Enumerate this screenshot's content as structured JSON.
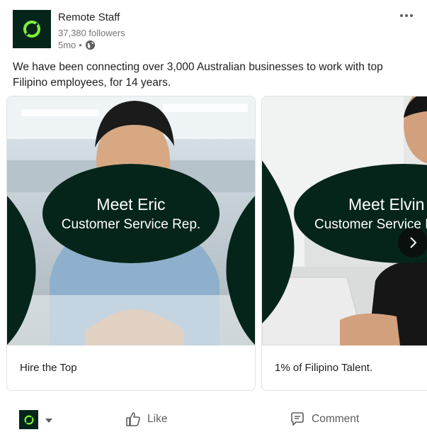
{
  "author": {
    "name": "Remote Staff",
    "followers": "37,380 followers",
    "age": "5mo",
    "separator": "•",
    "visibility_icon": "globe-icon",
    "brand_color": "#06251a",
    "accent_color": "#7ef03a"
  },
  "post": {
    "text": "We have been connecting over 3,000 Australian businesses to work with top Filipino employees, for 14 years."
  },
  "carousel": {
    "cards": [
      {
        "headline": "Meet Eric",
        "role": "Customer Service Rep.",
        "caption": "Hire the Top"
      },
      {
        "headline": "Meet Elvin",
        "role": "Customer Service Rep.",
        "caption": "1% of Filipino Talent."
      }
    ],
    "next_icon": "chevron-right-icon"
  },
  "actions": {
    "like": "Like",
    "comment": "Comment"
  }
}
